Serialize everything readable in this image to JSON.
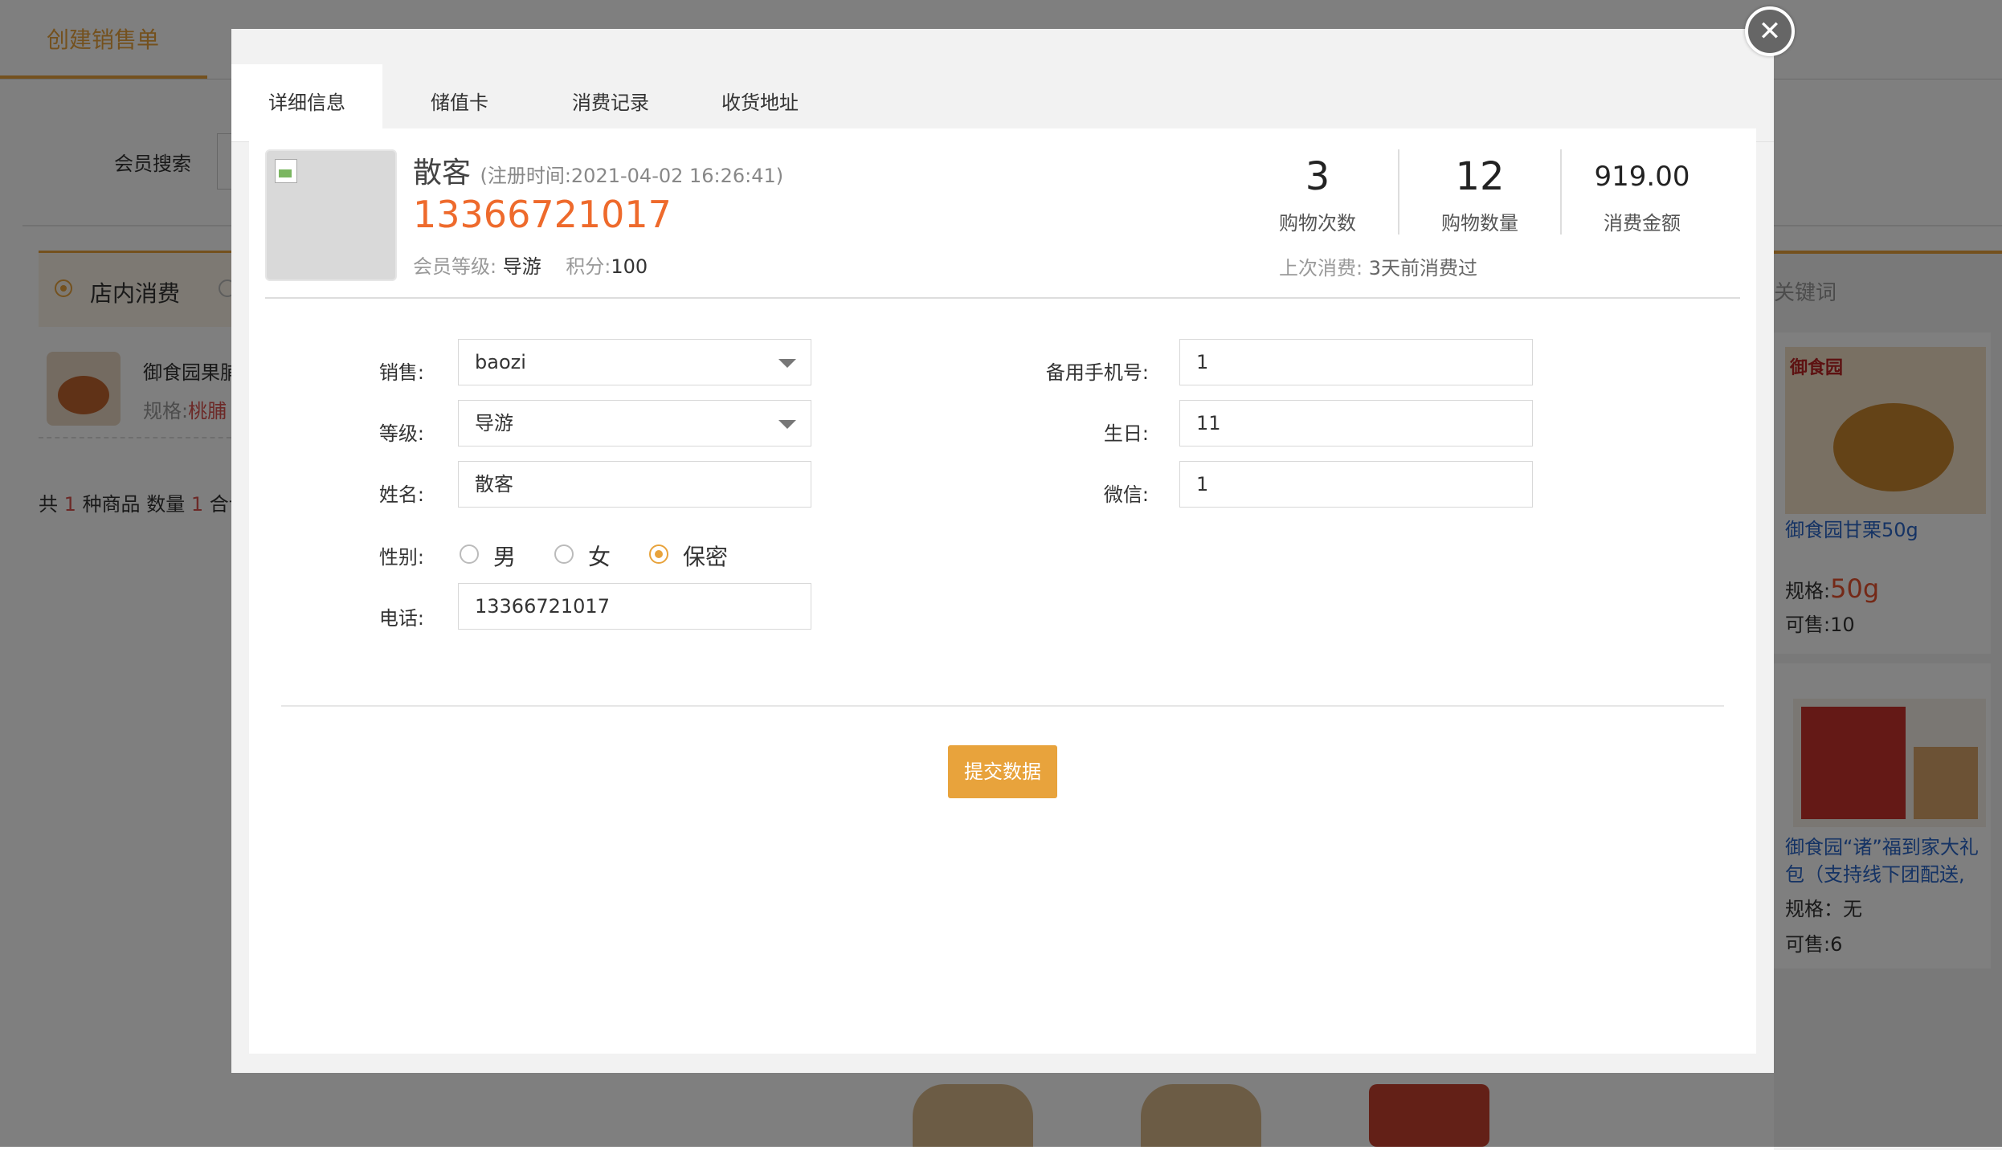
{
  "background": {
    "page_tab": "创建销售单",
    "member_search_label": "会员搜索",
    "in_store_label": "店内消费",
    "cart_item": {
      "name": "御食园果脯",
      "spec_label": "规格:",
      "spec_value": "桃脯"
    },
    "summary": {
      "prefix": "共",
      "kinds": "1",
      "kinds_suffix": "种商品 数量",
      "qty": "1",
      "tail": "合计"
    },
    "keyword_hint": "关键词",
    "products": [
      {
        "logo": "御食园",
        "name": "御食园甘栗50g",
        "spec_label": "规格:",
        "spec_value": "50g",
        "stock": "可售:10"
      },
      {
        "name": "御食园“诸”福到家大礼包（支持线下团配送,",
        "spec": "规格：无",
        "stock": "可售:6"
      }
    ]
  },
  "modal": {
    "tabs": [
      {
        "label": "详细信息",
        "active": true
      },
      {
        "label": "储值卡",
        "active": false
      },
      {
        "label": "消费记录",
        "active": false
      },
      {
        "label": "收货地址",
        "active": false
      }
    ],
    "close_icon": "close-icon",
    "member": {
      "name": "散客",
      "register_time": "(注册时间:2021-04-02 16:26:41)",
      "phone": "13366721017",
      "level_label": "会员等级:",
      "level_value": "导游",
      "points_label": "积分:",
      "points_value": "100"
    },
    "stats": [
      {
        "value": "3",
        "label": "购物次数"
      },
      {
        "value": "12",
        "label": "购物数量"
      },
      {
        "value": "919.00",
        "label": "消费金额"
      }
    ],
    "last_purchase_label": "上次消费:",
    "last_purchase_value": "3天前消费过",
    "form": {
      "sales_label": "销售:",
      "sales_value": "baozi",
      "level_label": "等级:",
      "level_value": "导游",
      "name_label": "姓名:",
      "name_value": "散客",
      "gender_label": "性别:",
      "gender_options": [
        {
          "label": "男",
          "selected": false
        },
        {
          "label": "女",
          "selected": false
        },
        {
          "label": "保密",
          "selected": true
        }
      ],
      "phone_label": "电话:",
      "phone_value": "13366721017",
      "backup_phone_label": "备用手机号:",
      "backup_phone_value": "1",
      "birthday_label": "生日:",
      "birthday_value": "11",
      "wechat_label": "微信:",
      "wechat_value": "1"
    },
    "submit_label": "提交数据"
  },
  "colors": {
    "accent": "#e8a33c",
    "phone": "#ee6a2c",
    "link": "#2a66c9"
  }
}
